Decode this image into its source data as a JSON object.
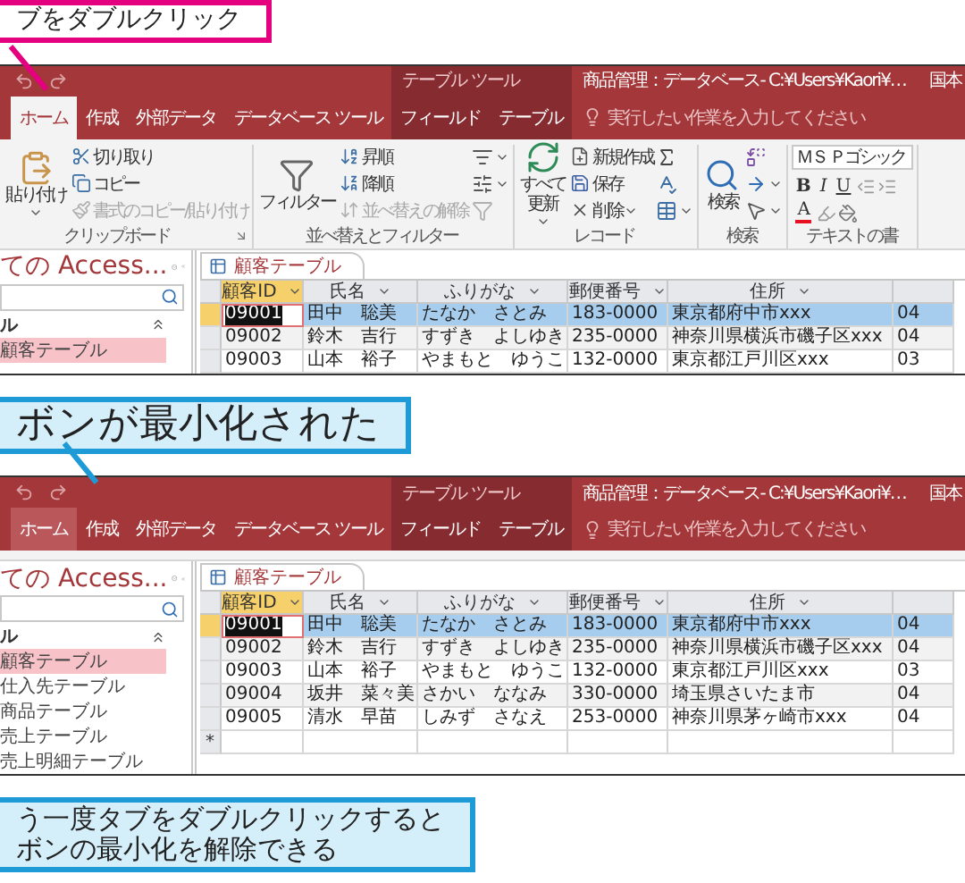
{
  "sections": [
    {
      "kind": "callout_magenta",
      "lines": [
        "ブをダブルクリック"
      ]
    },
    {
      "kind": "window",
      "context_label": "テーブル ツール",
      "title": "商品管理：データベース- C:¥Users¥Kaori¥…",
      "title_right": "国本",
      "tabs": [
        {
          "label": "ホーム",
          "selected": true,
          "contextual": false
        },
        {
          "label": "作成",
          "selected": false,
          "contextual": false
        },
        {
          "label": "外部データ",
          "selected": false,
          "contextual": false
        },
        {
          "label": "データベース ツール",
          "selected": false,
          "contextual": false
        },
        {
          "label": "フィールド",
          "selected": false,
          "contextual": true
        },
        {
          "label": "テーブル",
          "selected": false,
          "contextual": true
        }
      ],
      "tell_me": "実行したい作業を入力してください",
      "ribbon": {
        "groups": [
          {
            "label": "クリップボード",
            "launcher": true,
            "columns": [
              [
                {
                  "kind": "big",
                  "lines": [
                    "貼り付け"
                  ],
                  "dropdown": true
                }
              ],
              [
                {
                  "kind": "small",
                  "label": "切り取り",
                  "disabled": false
                },
                {
                  "kind": "small",
                  "label": "コピー",
                  "disabled": false
                },
                {
                  "kind": "small",
                  "label": "書式のコピー/貼り付け",
                  "disabled": true
                }
              ]
            ]
          },
          {
            "label": "並べ替えとフィルター",
            "launcher": false,
            "columns": [
              [
                {
                  "kind": "big",
                  "lines": [
                    "フィルター"
                  ],
                  "dropdown": false
                }
              ],
              [
                {
                  "kind": "small",
                  "label": "昇順",
                  "disabled": false
                },
                {
                  "kind": "small",
                  "label": "降順",
                  "disabled": false
                },
                {
                  "kind": "small",
                  "label": "並べ替えの解除",
                  "disabled": true
                }
              ],
              [
                {
                  "kind": "icon",
                  "dropdown": true,
                  "disabled": false
                },
                {
                  "kind": "icon",
                  "dropdown": true,
                  "disabled": false
                },
                {
                  "kind": "icon",
                  "dropdown": false,
                  "disabled": true
                }
              ]
            ]
          },
          {
            "label": "レコード",
            "launcher": false,
            "columns": [
              [
                {
                  "kind": "big",
                  "lines": [
                    "すべて",
                    "更新"
                  ],
                  "dropdown": true
                }
              ],
              [
                {
                  "kind": "small",
                  "label": "新規作成",
                  "disabled": false
                },
                {
                  "kind": "small",
                  "label": "保存",
                  "disabled": false
                },
                {
                  "kind": "small",
                  "label": "削除",
                  "disabled": false,
                  "dropdown": true
                }
              ],
              [
                {
                  "kind": "icon",
                  "dropdown": false,
                  "disabled": false
                },
                {
                  "kind": "icon",
                  "dropdown": false,
                  "disabled": false
                },
                {
                  "kind": "icon",
                  "dropdown": true,
                  "disabled": false
                }
              ]
            ]
          },
          {
            "label": "検索",
            "launcher": false,
            "columns": [
              [
                {
                  "kind": "big",
                  "lines": [
                    "検索"
                  ],
                  "dropdown": false
                }
              ],
              [
                {
                  "kind": "icon",
                  "dropdown": false,
                  "disabled": false
                },
                {
                  "kind": "icon",
                  "dropdown": true,
                  "disabled": false
                },
                {
                  "kind": "icon",
                  "dropdown": true,
                  "disabled": false
                }
              ]
            ]
          },
          {
            "label": "テキストの書",
            "launcher": false,
            "columns": [
              [
                {
                  "kind": "field",
                  "value": "ＭＳ Ｐゴシック"
                },
                {
                  "kind": "toolrow",
                  "buttons": [
                    {
                      "kind": "bold",
                      "label": "B"
                    },
                    {
                      "kind": "italic",
                      "label": "I"
                    },
                    {
                      "kind": "underline",
                      "label": "U"
                    },
                    {
                      "kind": "icon"
                    },
                    {
                      "kind": "icon"
                    }
                  ]
                },
                {
                  "kind": "toolrow",
                  "buttons": [
                    {
                      "kind": "font_color",
                      "label": "A",
                      "color": "#e81123"
                    },
                    {
                      "kind": "icon"
                    },
                    {
                      "kind": "icon"
                    }
                  ]
                }
              ]
            ]
          }
        ]
      },
      "nav": {
        "title": "ての Access...",
        "group": "ル",
        "items": [
          {
            "label": "顧客テーブル",
            "selected": true
          }
        ]
      },
      "table": {
        "tab": "顧客テーブル",
        "columns": [
          {
            "label": "顧客ID",
            "current": true
          },
          {
            "label": "氏名",
            "current": false
          },
          {
            "label": "ふりがな",
            "current": false
          },
          {
            "label": "郵便番号",
            "current": false
          },
          {
            "label": "住所",
            "current": false
          },
          {
            "current": false
          }
        ],
        "rows": [
          {
            "selected": true,
            "cells": [
              "09001",
              "田中　聡美",
              "たなか　さとみ",
              "183-0000",
              "東京都府中市xxx",
              "04"
            ]
          },
          {
            "selected": false,
            "cells": [
              "09002",
              "鈴木　吉行",
              "すずき　よしゆき",
              "235-0000",
              "神奈川県横浜市磯子区xxx",
              "04"
            ]
          },
          {
            "selected": false,
            "cells": [
              "09003",
              "山本　裕子",
              "やまもと　ゆうこ",
              "132-0000",
              "東京都江戸川区xxx",
              "03"
            ]
          }
        ]
      }
    },
    {
      "kind": "callout_cyan",
      "lines": [
        "ボンが最小化された"
      ]
    },
    {
      "kind": "window",
      "context_label": "テーブル ツール",
      "title": "商品管理：データベース- C:¥Users¥Kaori¥…",
      "title_right": "国本",
      "tabs": [
        {
          "label": "ホーム",
          "selected": true,
          "contextual": false
        },
        {
          "label": "作成",
          "selected": false,
          "contextual": false
        },
        {
          "label": "外部データ",
          "selected": false,
          "contextual": false
        },
        {
          "label": "データベース ツール",
          "selected": false,
          "contextual": false
        },
        {
          "label": "フィールド",
          "selected": false,
          "contextual": true
        },
        {
          "label": "テーブル",
          "selected": false,
          "contextual": true
        }
      ],
      "tell_me": "実行したい作業を入力してください",
      "nav": {
        "title": "ての Access...",
        "group": "ル",
        "items": [
          {
            "label": "顧客テーブル",
            "selected": true
          },
          {
            "label": "仕入先テーブル",
            "selected": false
          },
          {
            "label": "商品テーブル",
            "selected": false
          },
          {
            "label": "売上テーブル",
            "selected": false
          },
          {
            "label": "売上明細テーブル",
            "selected": false
          }
        ]
      },
      "table": {
        "tab": "顧客テーブル",
        "columns": [
          {
            "label": "顧客ID",
            "current": true
          },
          {
            "label": "氏名",
            "current": false
          },
          {
            "label": "ふりがな",
            "current": false
          },
          {
            "label": "郵便番号",
            "current": false
          },
          {
            "label": "住所",
            "current": false
          },
          {
            "current": false
          }
        ],
        "rows": [
          {
            "selected": true,
            "cells": [
              "09001",
              "田中　聡美",
              "たなか　さとみ",
              "183-0000",
              "東京都府中市xxx",
              "04"
            ]
          },
          {
            "selected": false,
            "cells": [
              "09002",
              "鈴木　吉行",
              "すずき　よしゆき",
              "235-0000",
              "神奈川県横浜市磯子区xxx",
              "04"
            ]
          },
          {
            "selected": false,
            "cells": [
              "09003",
              "山本　裕子",
              "やまもと　ゆうこ",
              "132-0000",
              "東京都江戸川区xxx",
              "03"
            ]
          },
          {
            "selected": false,
            "cells": [
              "09004",
              "坂井　菜々美",
              "さかい　ななみ",
              "330-0000",
              "埼玉県さいたま市",
              "04"
            ]
          },
          {
            "selected": false,
            "cells": [
              "09005",
              "清水　早苗",
              "しみず　さなえ",
              "253-0000",
              "神奈川県茅ヶ崎市xxx",
              "04"
            ]
          }
        ],
        "new_row": "*"
      }
    },
    {
      "kind": "callout_cyan",
      "lines": [
        "う一度タブをダブルクリックすると",
        "ボンの最小化を解除できる"
      ]
    }
  ]
}
